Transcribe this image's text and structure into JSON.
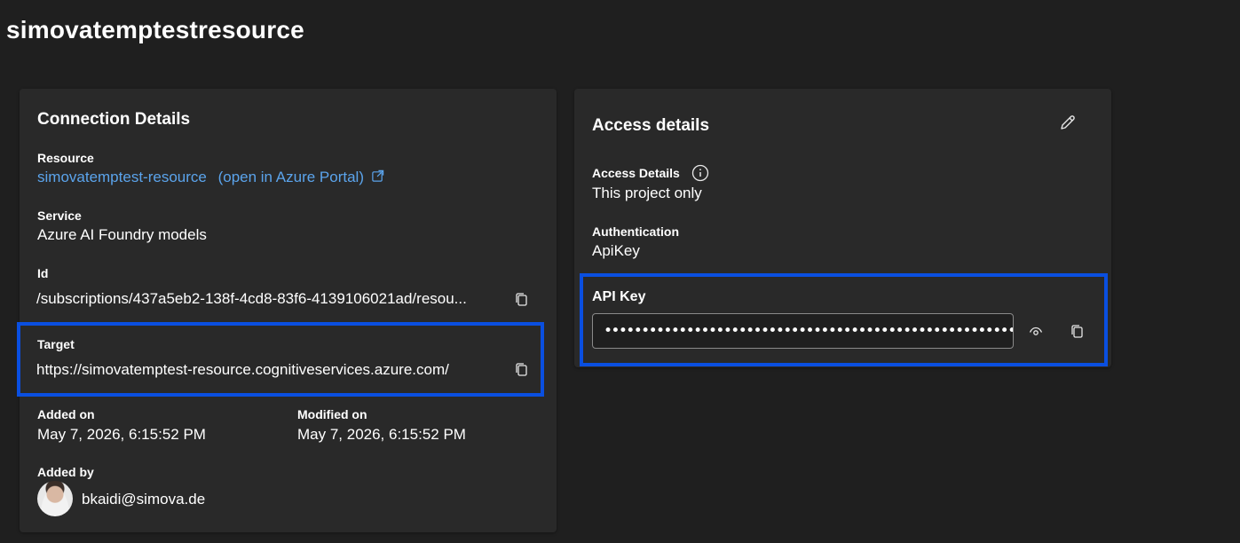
{
  "page": {
    "title": "simovatemptestresource"
  },
  "connection": {
    "title": "Connection Details",
    "resource": {
      "label": "Resource",
      "name": "simovatemptest-resource",
      "portal_link": "(open in Azure Portal)",
      "icon": "external-link-icon"
    },
    "service": {
      "label": "Service",
      "value": "Azure AI Foundry models"
    },
    "id": {
      "label": "Id",
      "value": "/subscriptions/437a5eb2-138f-4cd8-83f6-4139106021ad/resou...",
      "icon": "copy-icon"
    },
    "target": {
      "label": "Target",
      "value": "https://simovatemptest-resource.cognitiveservices.azure.com/",
      "icon": "copy-icon"
    },
    "added_on": {
      "label": "Added on",
      "value": "May 7, 2026, 6:15:52 PM"
    },
    "modified_on": {
      "label": "Modified on",
      "value": "May 7, 2026, 6:15:52 PM"
    },
    "added_by": {
      "label": "Added by",
      "value": "bkaidi@simova.de",
      "icon": "avatar"
    }
  },
  "access": {
    "title": "Access details",
    "edit_icon": "pencil-icon",
    "access_details": {
      "label": "Access Details",
      "value": "This project only",
      "icon": "info-icon"
    },
    "authentication": {
      "label": "Authentication",
      "value": "ApiKey"
    },
    "api_key": {
      "label": "API Key",
      "value": "••••••••••••••••••••••••••••••••••••••••••••••••••••••••••••••",
      "show_icon": "eye-icon",
      "copy_icon": "copy-icon"
    }
  },
  "colors": {
    "highlight": "#0a4fe0",
    "link": "#5ba4ec",
    "background": "#1f1f1f",
    "card": "#292929"
  }
}
